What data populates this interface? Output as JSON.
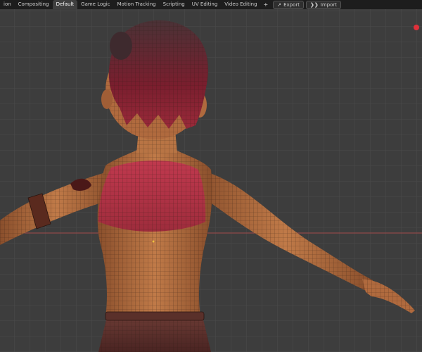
{
  "workspace_tabs": [
    {
      "label": "ion",
      "active": false
    },
    {
      "label": "Compositing",
      "active": false
    },
    {
      "label": "Default",
      "active": true
    },
    {
      "label": "Game Logic",
      "active": false
    },
    {
      "label": "Motion Tracking",
      "active": false
    },
    {
      "label": "Scripting",
      "active": false
    },
    {
      "label": "UV Editing",
      "active": false
    },
    {
      "label": "Video Editing",
      "active": false
    }
  ],
  "add_tab_glyph": "+",
  "export_label": "Export",
  "import_label": "Import",
  "colors": {
    "topbar": "#1d1d1d",
    "viewport_bg": "#3d3d3d",
    "grid_line": "#4a4a4a",
    "x_axis": "#a24a4a",
    "record_dot": "#e0303a",
    "skin": "#b06a3e",
    "top_red": "#b8384c",
    "hair": "#6a1d2a",
    "wire": "#2a1a10"
  },
  "icons": {
    "export": "export-arrow-icon",
    "import": "import-arrow-icon",
    "record": "record-dot-icon"
  }
}
